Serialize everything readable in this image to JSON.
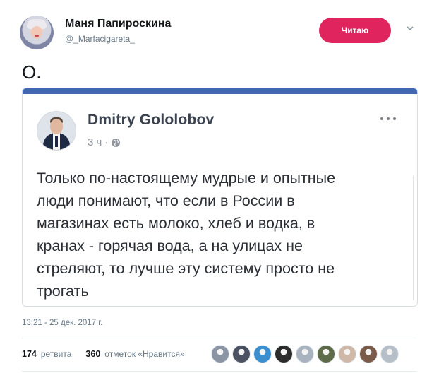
{
  "tweet": {
    "author": {
      "name": "Маня Папироскина",
      "handle": "@_Marfacigareta_"
    },
    "follow_button": "Читаю",
    "text": "О.",
    "timestamp": "13:21 - 25 дек. 2017 г.",
    "retweets": {
      "count": "174",
      "label": "ретвита"
    },
    "likes": {
      "count": "360",
      "label": "отметок «Нравится»"
    },
    "likers": [
      {
        "icon": "avatar",
        "color": "#8a94a3"
      },
      {
        "icon": "avatar",
        "color": "#4b5262"
      },
      {
        "icon": "avatar",
        "color": "#3c8fcf"
      },
      {
        "icon": "avatar",
        "color": "#2b2b2b"
      },
      {
        "icon": "avatar",
        "color": "#a9b3bf"
      },
      {
        "icon": "avatar",
        "color": "#5d6b4b"
      },
      {
        "icon": "avatar",
        "color": "#cfb8a8"
      },
      {
        "icon": "avatar",
        "color": "#7a5a48"
      },
      {
        "icon": "avatar",
        "color": "#b6bec8"
      }
    ]
  },
  "facebook_post": {
    "author": "Dmitry Gololobov",
    "time": "3 ч",
    "separator": "·",
    "text": "Только по-настоящему мудрые и опытные\nлюди понимают, что если в России в\nмагазинах есть молоко, хлеб и водка, в\nкранах - горячая вода, а на улицах не\nстреляют, то лучше эту систему просто не\nтрогать"
  },
  "colors": {
    "follow_button": "#e0245e",
    "facebook_bar": "#4267b2",
    "muted": "#657786"
  }
}
